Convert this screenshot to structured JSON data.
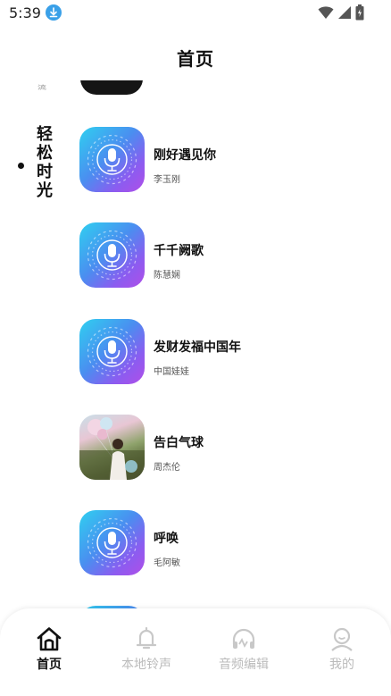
{
  "status_bar": {
    "time": "5:39",
    "icons": [
      "download-icon",
      "wifi-icon",
      "signal-icon",
      "battery-icon"
    ]
  },
  "header": {
    "title": "首页"
  },
  "sidebar": {
    "partial_label": "流",
    "active_category": "轻松时光"
  },
  "songs": [
    {
      "name": "刚好遇见你",
      "artist": "李玉刚",
      "cover": "microphone-cover"
    },
    {
      "name": "千千阙歌",
      "artist": "陈慧娴",
      "cover": "microphone-cover"
    },
    {
      "name": "发财发福中国年",
      "artist": "中国娃娃",
      "cover": "microphone-cover"
    },
    {
      "name": "告白气球",
      "artist": "周杰伦",
      "cover": "photo-cover"
    },
    {
      "name": "呼唤",
      "artist": "毛阿敏",
      "cover": "microphone-cover"
    }
  ],
  "bottom_nav": {
    "items": [
      {
        "label": "首页",
        "icon": "home-icon",
        "active": true
      },
      {
        "label": "本地铃声",
        "icon": "bell-icon",
        "active": false
      },
      {
        "label": "音频编辑",
        "icon": "headphones-icon",
        "active": false
      },
      {
        "label": "我的",
        "icon": "profile-icon",
        "active": false
      }
    ]
  },
  "colors": {
    "accent_gradient_start": "#2fd0f0",
    "accent_gradient_end": "#b04ee8",
    "nav_active": "#111111",
    "nav_inactive": "#bbbbbb"
  }
}
